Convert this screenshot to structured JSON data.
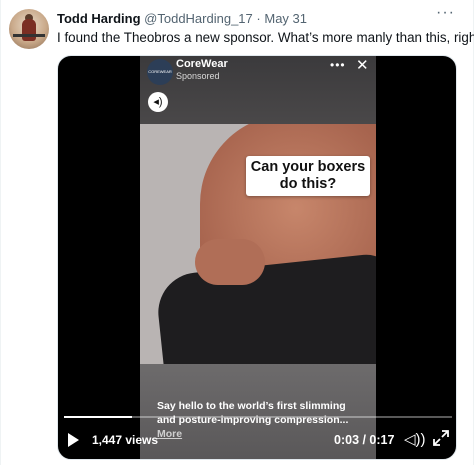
{
  "tweet": {
    "author_name": "Todd Harding",
    "handle": "@ToddHarding_17",
    "separator": "·",
    "date": "May 31",
    "more_glyph": "···",
    "text": "I found the Theobros a new sponsor. What’s more manly than this, right?"
  },
  "ad": {
    "brand_logo_text": "COREWEAR",
    "brand_name": "CoreWear",
    "sponsored_label": "Sponsored",
    "menu_glyph": "•••",
    "close_glyph": "✕",
    "sound_glyph": "◂)",
    "callout_text": "Can your boxers do this?",
    "caption_text": "Say hello to the world’s first slimming and posture-improving compression...",
    "caption_more": "More"
  },
  "video": {
    "views": "1,447 views",
    "time": "0:03 / 0:17",
    "progress_fraction": 0.176,
    "volume_glyph": "◁))",
    "accent_color": "#ffffff"
  }
}
